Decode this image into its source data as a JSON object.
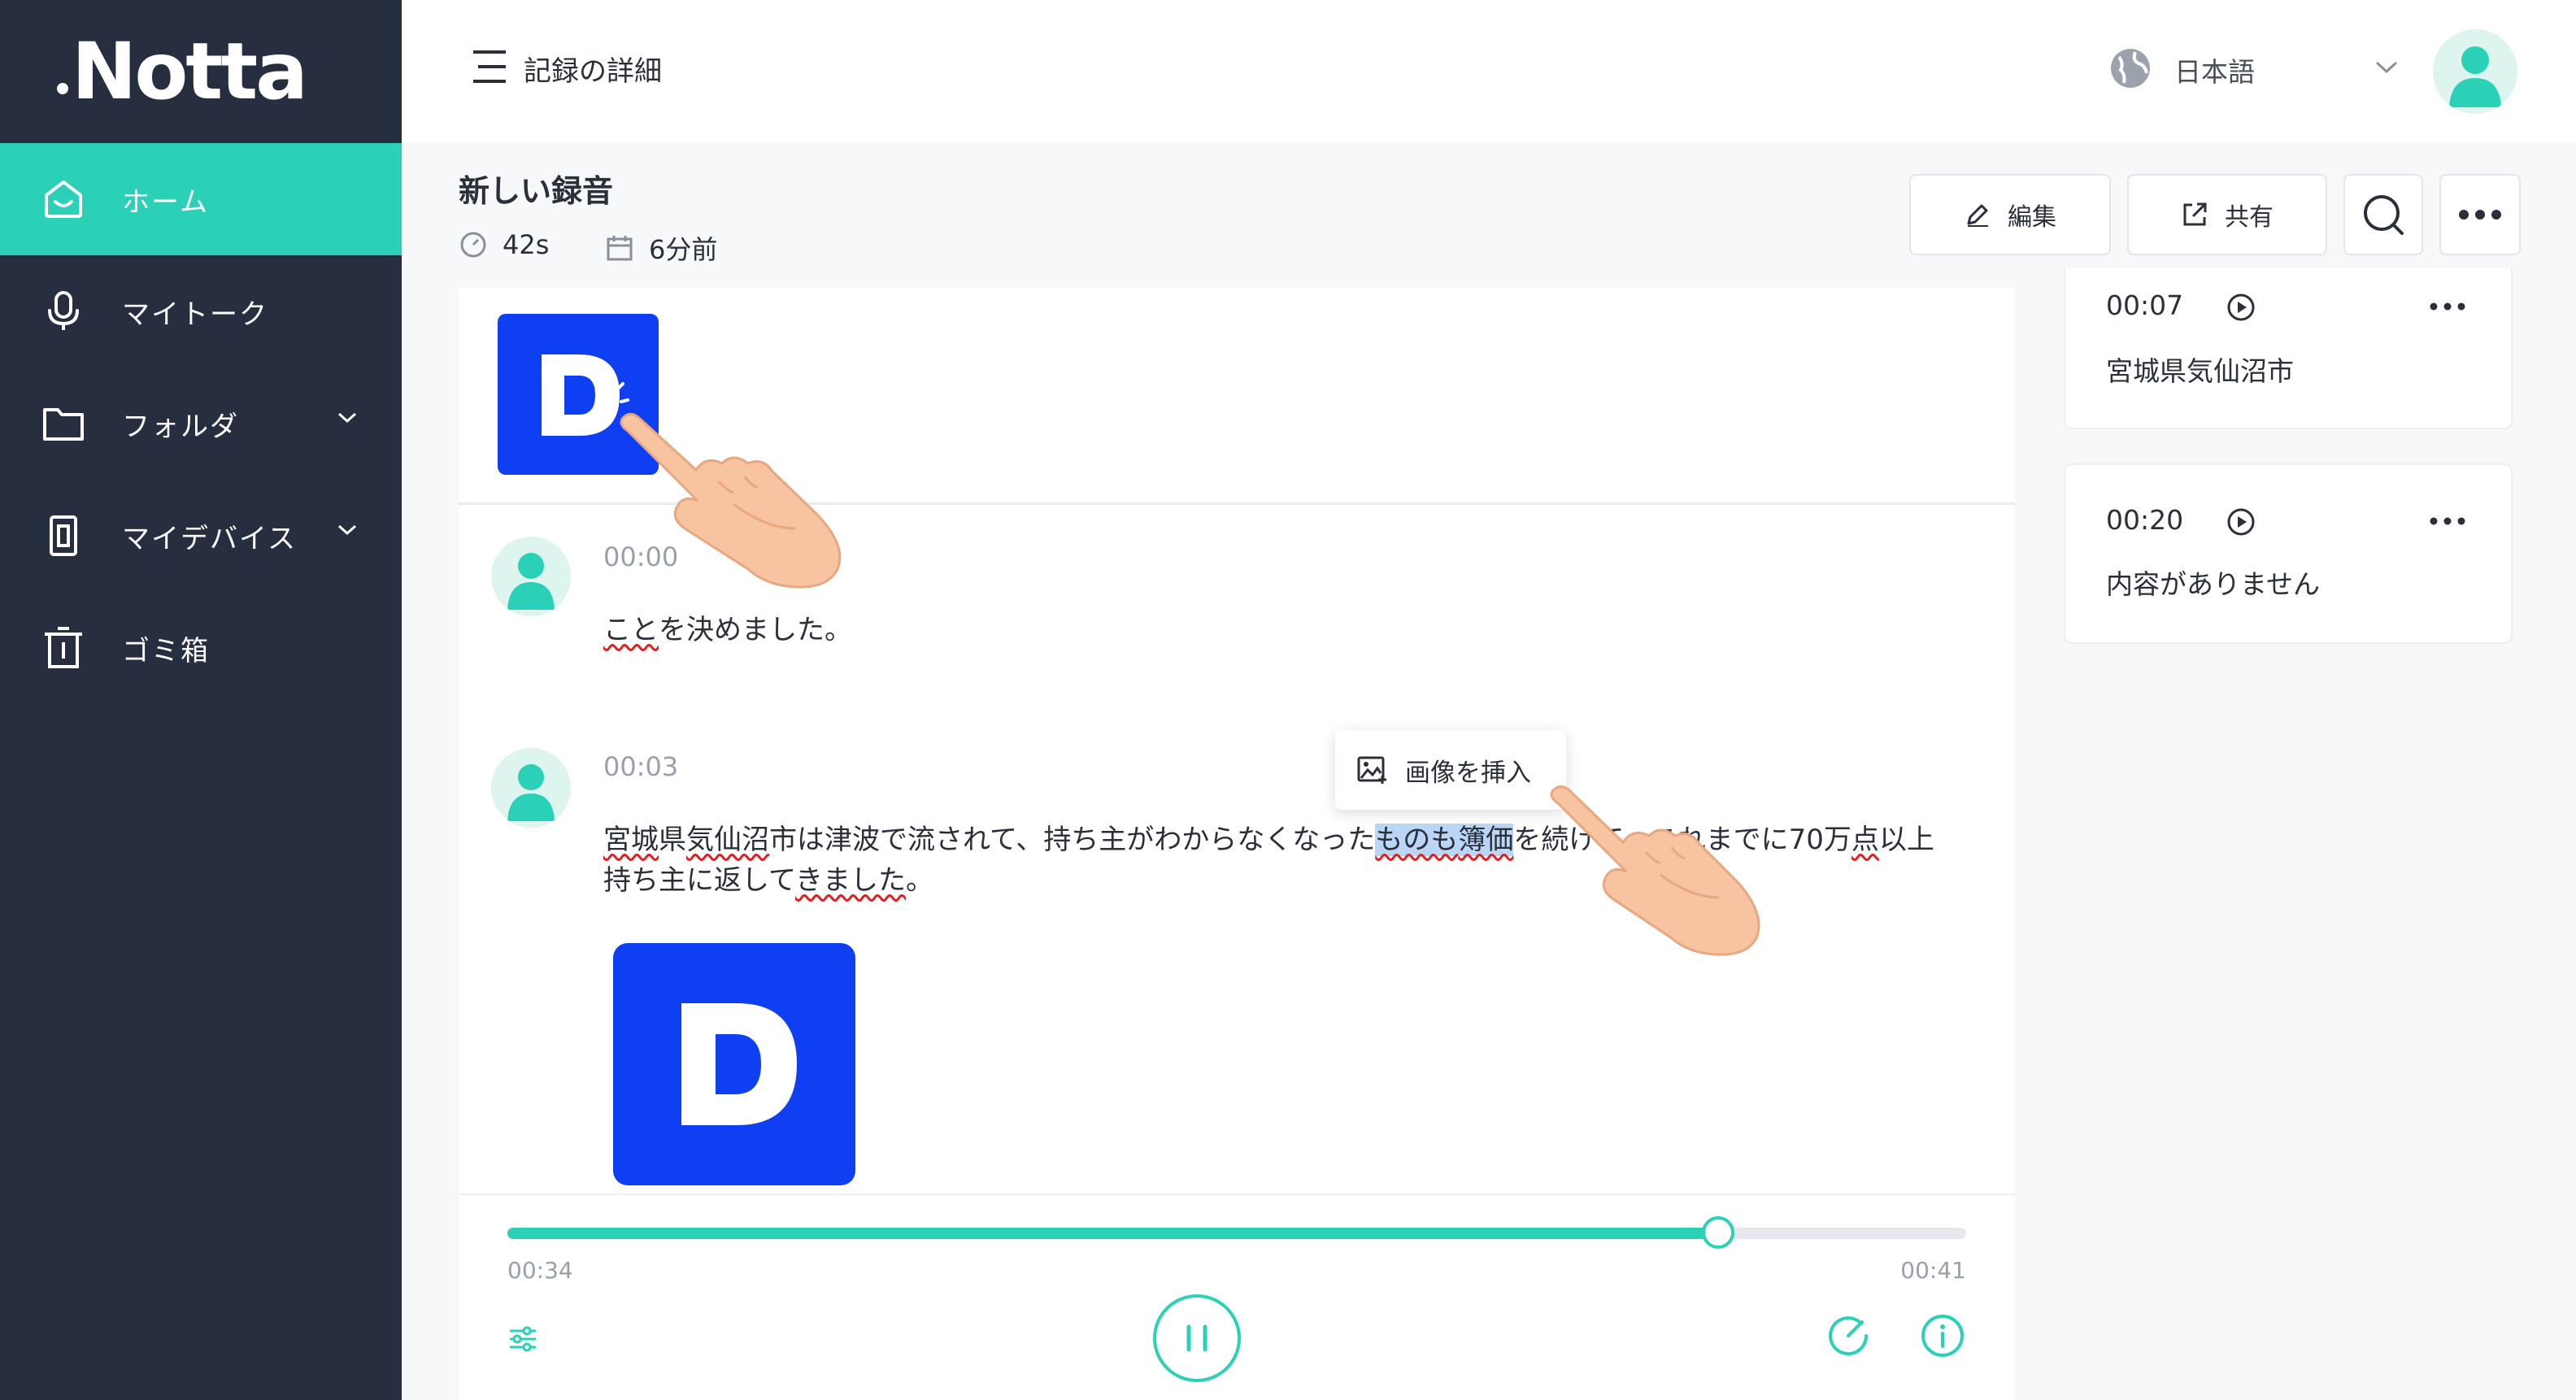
{
  "app": {
    "name": "Notta"
  },
  "sidebar": {
    "items": [
      {
        "label": "ホーム",
        "icon": "home-icon",
        "active": true
      },
      {
        "label": "マイトーク",
        "icon": "microphone-icon"
      },
      {
        "label": "フォルダ",
        "icon": "folder-icon",
        "expandable": true
      },
      {
        "label": "マイデバイス",
        "icon": "device-icon",
        "expandable": true
      },
      {
        "label": "ゴミ箱",
        "icon": "trash-icon"
      }
    ]
  },
  "topbar": {
    "title": "記録の詳細",
    "language": "日本語"
  },
  "recording": {
    "title": "新しい録音",
    "duration": "42s",
    "created": "6分前",
    "edit_label": "編集",
    "share_label": "共有"
  },
  "transcript": {
    "segments": [
      {
        "time": "00:00",
        "text_parts": [
          "こと",
          "を決めました。"
        ]
      },
      {
        "time": "00:03",
        "line1_parts": [
          "宮城",
          "県",
          "気仙沼",
          "市",
          "は津波で流されて、持ち主がわからなくなった",
          "ものも",
          "簿価",
          "を続けて、これまでに70万",
          "点",
          "以上"
        ],
        "line2_parts": [
          "持ち主に返して",
          "きました",
          "。"
        ]
      }
    ],
    "context_menu": {
      "insert_image_label": "画像を挿入"
    }
  },
  "player": {
    "current_time": "00:34",
    "total_time": "00:41",
    "progress_fraction": 0.83
  },
  "highlights": [
    {
      "time": "00:07",
      "text": "宮城県気仙沼市"
    },
    {
      "time": "00:20",
      "text": "内容がありません"
    }
  ],
  "colors": {
    "accent": "#2bd1b6",
    "sidebar": "#262e40",
    "brand_blue": "#0e3ff3",
    "selection": "#b9d6f7"
  }
}
